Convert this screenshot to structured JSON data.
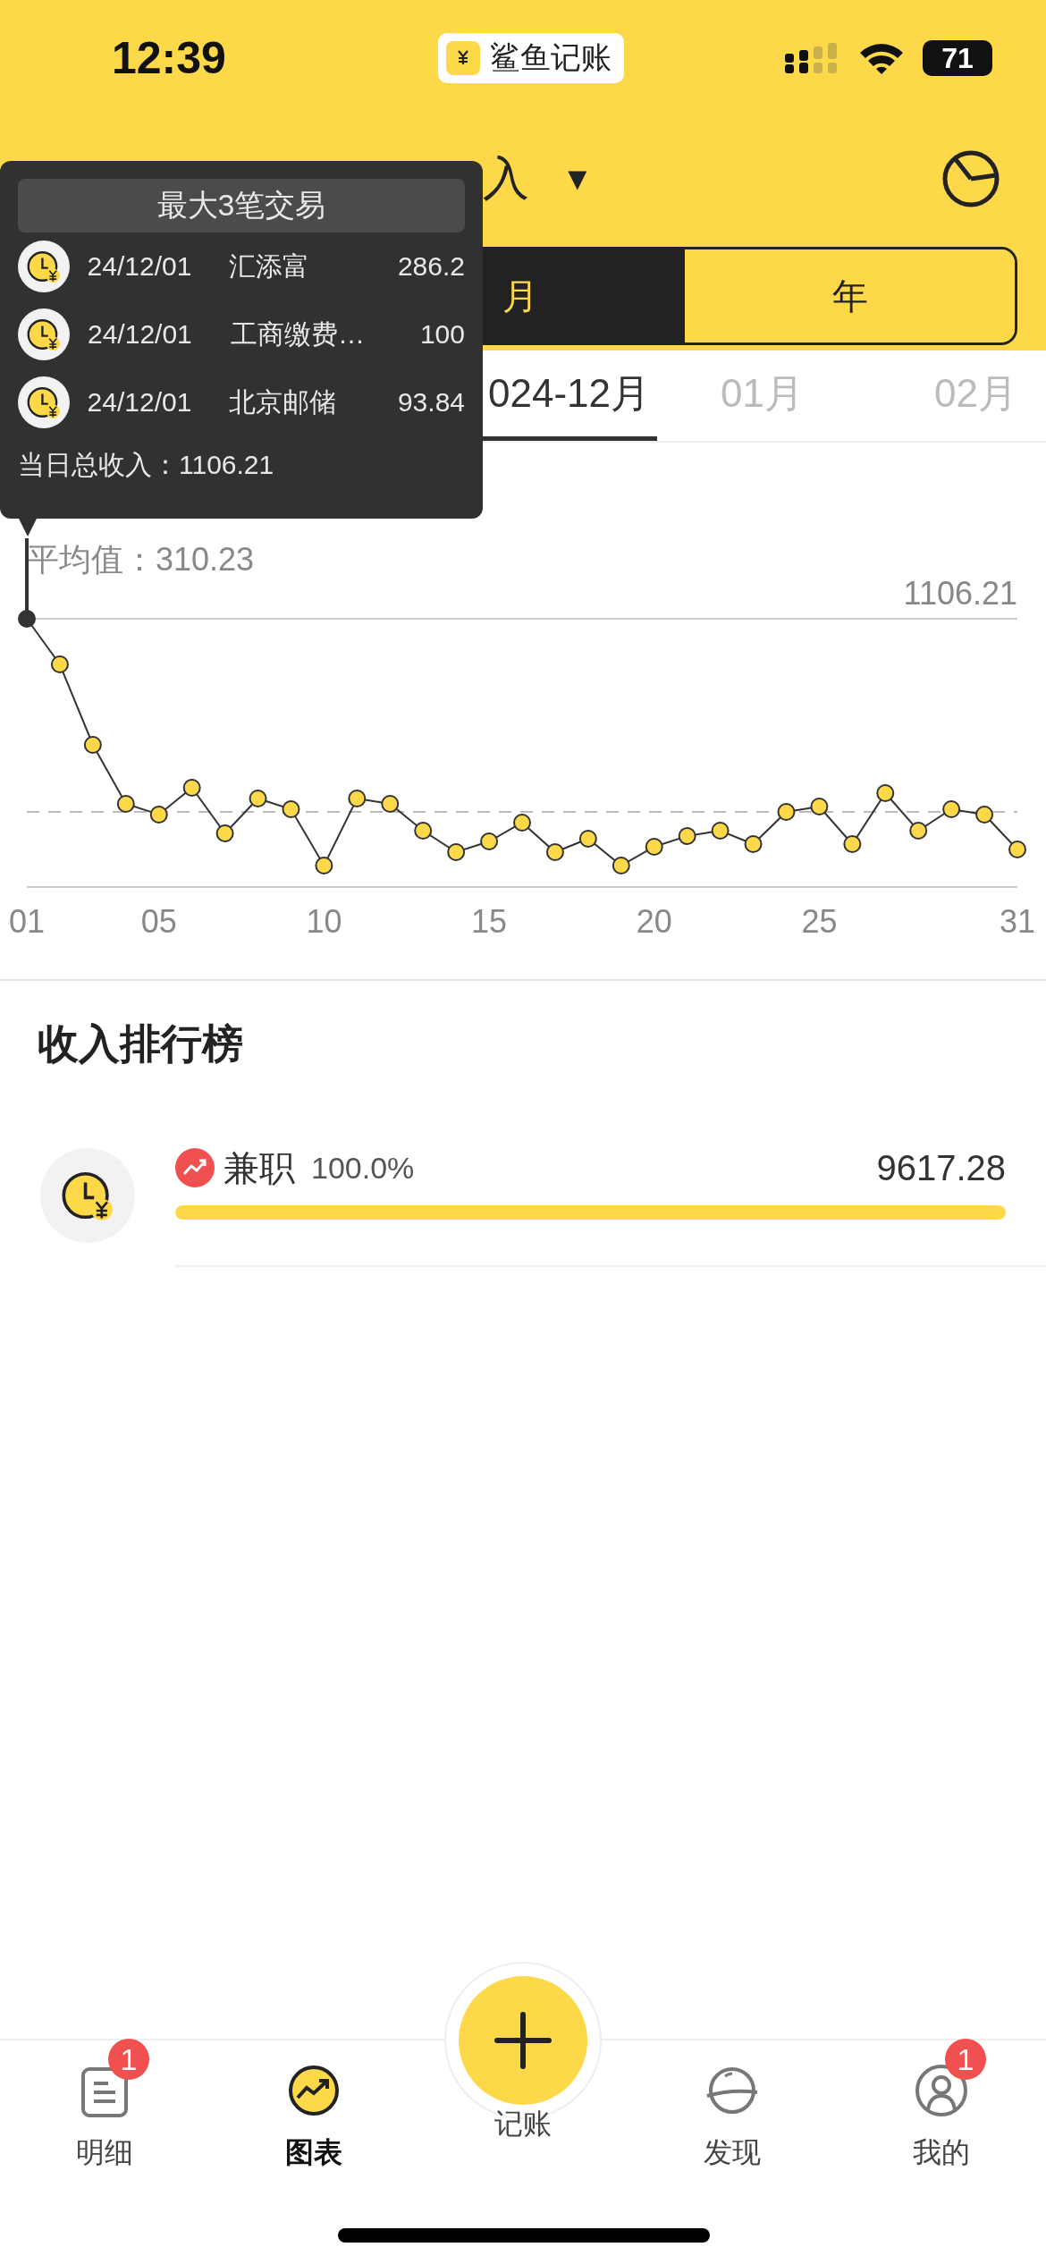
{
  "status_bar": {
    "time": "12:39",
    "app_badge": "鲨鱼记账",
    "battery": "71"
  },
  "header": {
    "title": "入",
    "caret": "▼"
  },
  "segments": [
    {
      "label": "月",
      "selected": true
    },
    {
      "label": "年",
      "selected": false
    }
  ],
  "periods": [
    {
      "label": "024-12月",
      "selected": true
    },
    {
      "label": "01月",
      "selected": false
    },
    {
      "label": "02月",
      "selected": false
    }
  ],
  "tooltip": {
    "title": "最大3笔交易",
    "rows": [
      {
        "date": "24/12/01",
        "name": "汇添富",
        "amount": "286.2"
      },
      {
        "date": "24/12/01",
        "name": "工商缴费…",
        "amount": "100"
      },
      {
        "date": "24/12/01",
        "name": "北京邮储",
        "amount": "93.84"
      }
    ],
    "total": "当日总收入：1106.21"
  },
  "chart": {
    "average_label": "平均值：310.23",
    "max_label": "1106.21",
    "x_labels": [
      "01",
      "05",
      "10",
      "15",
      "20",
      "25",
      "31"
    ]
  },
  "ranking": {
    "title": "收入排行榜",
    "items": [
      {
        "name": "兼职",
        "percent": "100.0%",
        "amount": "9617.28",
        "level": 1
      }
    ]
  },
  "tab_bar": {
    "items": [
      {
        "label": "明细",
        "kind": "list",
        "badge": "1",
        "selected": false
      },
      {
        "label": "图表",
        "kind": "chart",
        "selected": true
      },
      {
        "label": "记账",
        "kind": "add",
        "selected": false
      },
      {
        "label": "发现",
        "kind": "planet",
        "selected": false
      },
      {
        "label": "我的",
        "kind": "profile",
        "badge": "1",
        "selected": false
      }
    ]
  }
}
